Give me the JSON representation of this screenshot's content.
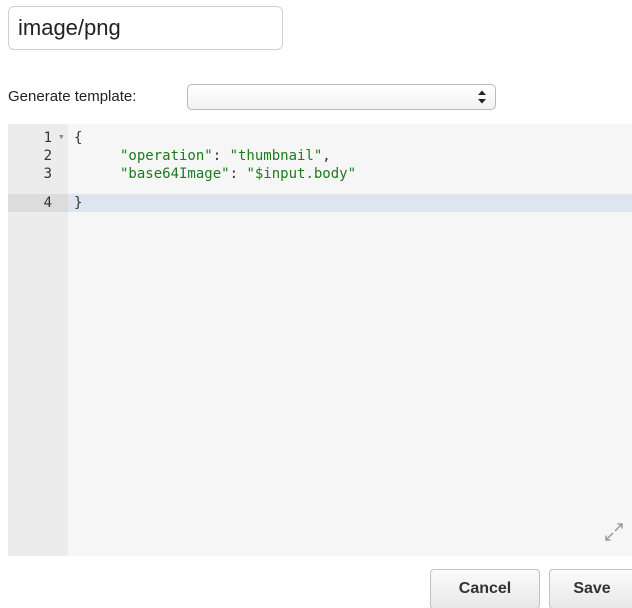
{
  "content_type": {
    "value": "image/png"
  },
  "generate_template": {
    "label": "Generate template:",
    "selected": ""
  },
  "editor": {
    "active_line": 4,
    "lines": [
      {
        "number": "1",
        "fold": "▾",
        "text": "{",
        "key": "",
        "sep": "",
        "val": "",
        "end": ""
      },
      {
        "number": "2",
        "fold": "",
        "text": "",
        "key": "\"operation\"",
        "sep": ": ",
        "val": "\"thumbnail\"",
        "end": ","
      },
      {
        "number": "3",
        "fold": "",
        "text": "",
        "key": "\"base64Image\"",
        "sep": ": ",
        "val": "\"$input.body\"",
        "end": ""
      },
      {
        "number": "4",
        "fold": "",
        "text": "}",
        "key": "",
        "sep": "",
        "val": "",
        "end": ""
      }
    ],
    "resize_icon": "expand-icon"
  },
  "actions": {
    "cancel_label": "Cancel",
    "save_label": "Save"
  }
}
